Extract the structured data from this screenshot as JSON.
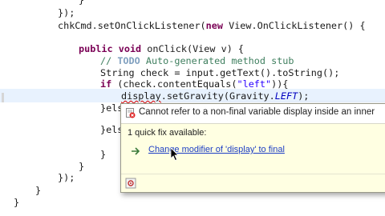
{
  "code": {
    "l0_tail": "}",
    "l1": "});",
    "l2_pre": "chkCmd.setOnClickListener(",
    "l2_kw": "new",
    "l2_post": " View.OnClickListener() {",
    "l4_kw1": "public",
    "l4_kw2": "void",
    "l4_post": " onClick(View v) {",
    "l5_pre": "// ",
    "l5_todo": "TODO",
    "l5_post": " Auto-generated method stub",
    "l6": "String check = input.getText().toString();",
    "l7_kw": "if",
    "l7_mid": " (check.contentEquals(",
    "l7_str": "\"left\"",
    "l7_post": ")){",
    "l8_var": "display",
    "l8_mid": ".setGravity(Gravity.",
    "l8_fld": "LEFT",
    "l8_post": ");",
    "l9": "}els",
    "l10": "}els",
    "l11": "}",
    "l12": "}",
    "l13": "});",
    "l14": "}",
    "l15": "}"
  },
  "quickfix": {
    "error_message": "Cannot refer to a non-final variable display inside an inner",
    "fix_count": "1 quick fix available:",
    "fix_label": "Change modifier of 'display' to final"
  },
  "icons": {
    "error": "error-icon",
    "fix": "quickfix-arrow-icon",
    "footer": "settings-icon",
    "pointer": "mouse-pointer-icon"
  },
  "colors": {
    "keyword": "#7a0055",
    "string": "#2a00ff",
    "comment": "#3f7f5f",
    "link": "#1d3ec4",
    "popup_bg": "#ffffe2"
  }
}
